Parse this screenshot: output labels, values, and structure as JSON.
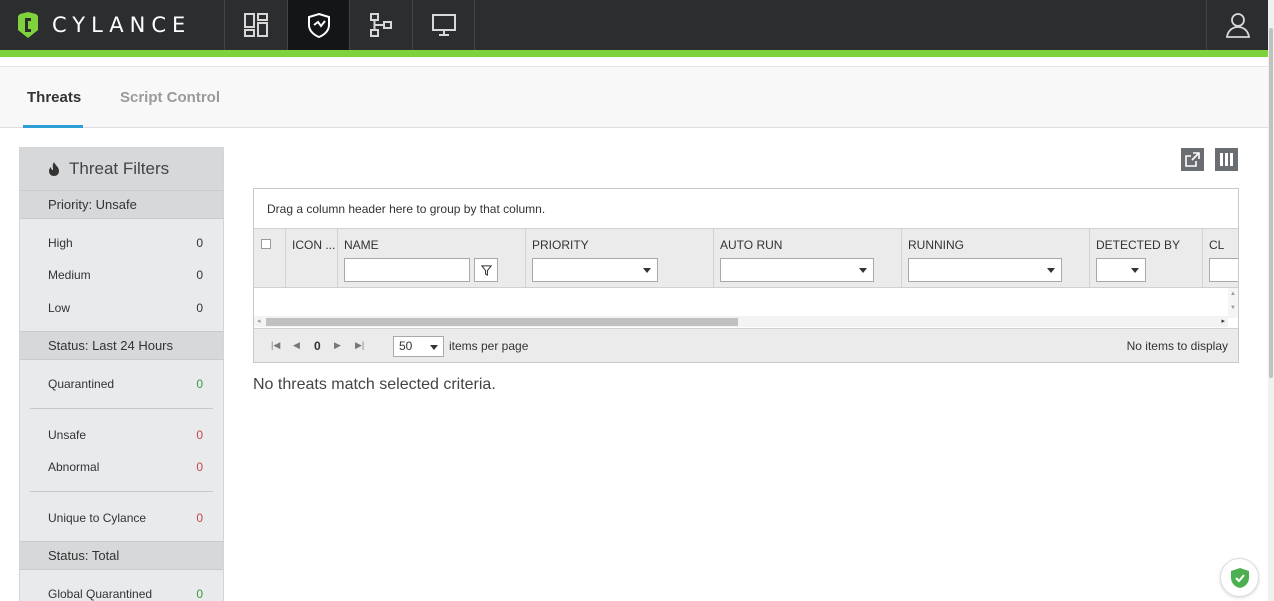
{
  "header": {
    "logo_text": "CYLANCE",
    "nav": [
      {
        "name": "dashboard-icon",
        "active": false
      },
      {
        "name": "protection-shield-icon",
        "active": true
      },
      {
        "name": "zones-icon",
        "active": false
      },
      {
        "name": "devices-icon",
        "active": false
      }
    ],
    "user_icon": "user-icon",
    "accent_color": "#7fd23c"
  },
  "tabs": [
    {
      "label": "Threats",
      "active": true
    },
    {
      "label": "Script Control",
      "active": false
    }
  ],
  "sidebar": {
    "title": "Threat Filters",
    "title_icon": "flame-icon",
    "sections": [
      {
        "label": "Priority: Unsafe",
        "items": [
          {
            "label": "High",
            "count": "0"
          },
          {
            "label": "Medium",
            "count": "0"
          },
          {
            "label": "Low",
            "count": "0"
          }
        ]
      },
      {
        "label": "Status: Last 24 Hours",
        "items": [
          {
            "label": "Quarantined",
            "count": "0",
            "color": "#3a9a3a"
          },
          {
            "label": "Unsafe",
            "count": "0",
            "color": "#c84646"
          },
          {
            "label": "Abnormal",
            "count": "0",
            "color": "#c84646"
          },
          {
            "label": "Unique to Cylance",
            "count": "0",
            "color": "#c84646"
          }
        ]
      },
      {
        "label": "Status: Total",
        "items": [
          {
            "label": "Global Quarantined",
            "count": "0",
            "color": "#3a9a3a"
          }
        ]
      }
    ]
  },
  "toolbar": {
    "export_icon": "export-icon",
    "columns_icon": "columns-icon"
  },
  "grid": {
    "group_hint": "Drag a column header here to group by that column.",
    "columns": [
      "ICON ...",
      "NAME",
      "PRIORITY",
      "AUTO RUN",
      "RUNNING",
      "DETECTED BY",
      "CL"
    ],
    "pager": {
      "page": "0",
      "page_size": "50",
      "page_size_label": "items per page",
      "info": "No items to display"
    }
  },
  "empty_message": "No threats match selected criteria."
}
